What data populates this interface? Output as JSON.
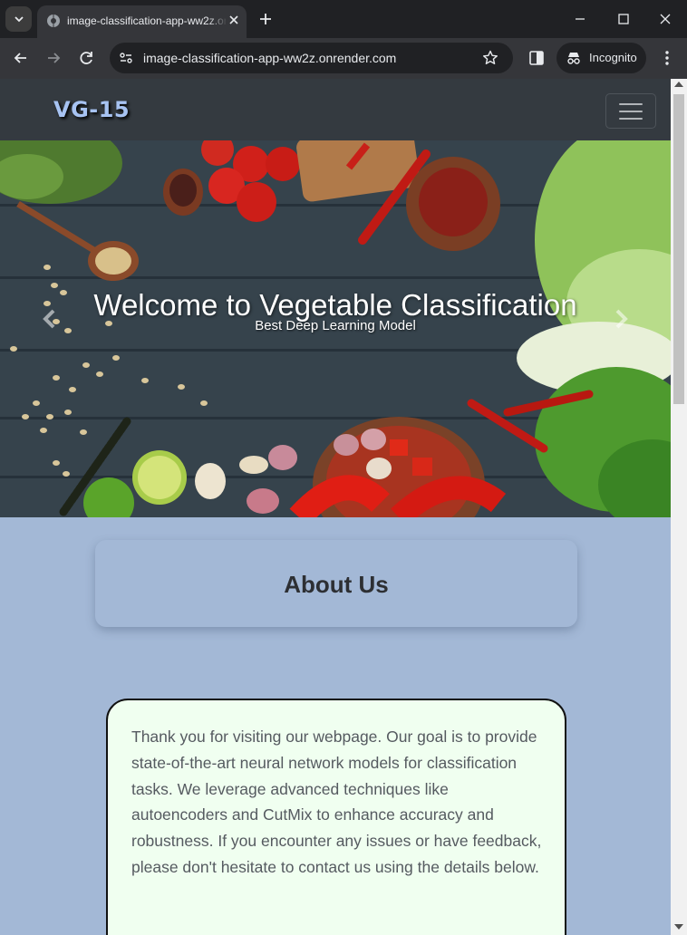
{
  "browser": {
    "tab_title": "image-classification-app-ww2z.onrender.com",
    "url": "image-classification-app-ww2z.onrender.com",
    "incognito_label": "Incognito"
  },
  "navbar": {
    "brand": "VG-15"
  },
  "hero": {
    "title": "Welcome to Vegetable Classification",
    "subtitle": "Best Deep Learning Model"
  },
  "about": {
    "title": "About Us",
    "text": "Thank you for visiting our webpage. Our goal is to provide state-of-the-art neural network models for classification tasks. We leverage advanced techniques like autoencoders and CutMix to enhance accuracy and robustness. If you encounter any issues or have feedback, please don't hesitate to contact us using the details below."
  },
  "colors": {
    "navbar_bg": "#343a40",
    "brand_text": "#a7c3f2",
    "page_bg": "#a3b8d6",
    "info_box_bg": "#f0fff0"
  },
  "icons": [
    "tab-search-icon",
    "globe-icon",
    "close-icon",
    "plus-icon",
    "minimize-icon",
    "maximize-icon",
    "back-arrow-icon",
    "forward-arrow-icon",
    "reload-icon",
    "site-info-icon",
    "star-icon",
    "side-panel-icon",
    "incognito-icon",
    "kebab-menu-icon",
    "hamburger-icon",
    "chevron-left-icon",
    "chevron-right-icon"
  ]
}
